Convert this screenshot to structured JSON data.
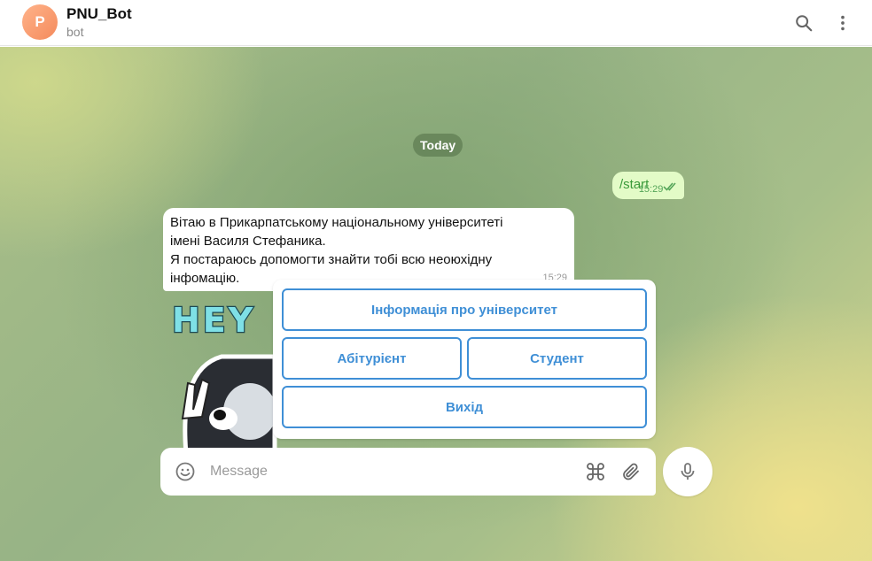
{
  "header": {
    "avatar_letter": "P",
    "title": "PNU_Bot",
    "subtitle": "bot",
    "icons": [
      "search-icon",
      "more-vertical-icon"
    ]
  },
  "chat": {
    "date_separator": "Today",
    "outgoing_message": {
      "text": "/start",
      "time": "15:29",
      "status": "read"
    },
    "incoming_message": {
      "lines": [
        "Вітаю в Прикарпатському національному університеті",
        "імені Василя Стефаника.",
        "Я постараюсь допомогти знайти тобі всю неоюхідну",
        "інфомацію."
      ],
      "time": "15:29"
    },
    "sticker": {
      "text": "HEY"
    }
  },
  "keyboard": {
    "buttons": [
      {
        "label": "Інформація про університет"
      },
      {
        "label": "Абітурієнт"
      },
      {
        "label": "Студент"
      },
      {
        "label": "Вихід"
      }
    ]
  },
  "composer": {
    "placeholder": "Message",
    "icons": [
      "emoji-icon",
      "command-icon",
      "attach-icon",
      "microphone-icon"
    ]
  },
  "colors": {
    "accent": "#3f8fd6",
    "outgoing_bubble": "#e3fbc7",
    "outgoing_text": "#3a9a3a"
  }
}
